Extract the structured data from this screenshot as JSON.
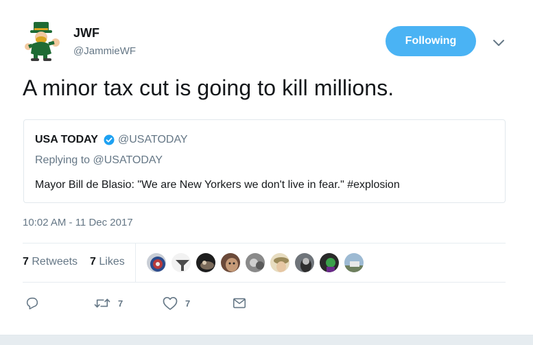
{
  "author": {
    "name": "JWF",
    "handle": "@JammieWF"
  },
  "follow_button": {
    "label": "Following"
  },
  "tweet_text": "A minor tax cut is going to kill millions.",
  "quoted": {
    "name": "USA TODAY",
    "handle": "@USATODAY",
    "replying_to": "Replying to @USATODAY",
    "text": "Mayor Bill de Blasio: \"We are New Yorkers we don't live in fear.\" #explosion"
  },
  "timestamp": "10:02 AM - 11 Dec 2017",
  "stats": {
    "retweets_count": "7",
    "retweets_label": "Retweets",
    "likes_count": "7",
    "likes_label": "Likes"
  },
  "actions": {
    "reply_count": "",
    "retweet_count": "7",
    "like_count": "7"
  },
  "colors": {
    "accent": "#4ab3f4",
    "secondary_text": "#657786",
    "primary_text": "#14171a",
    "border": "#e1e8ed"
  },
  "icons": [
    "reply-icon",
    "retweet-icon",
    "heart-icon",
    "message-icon",
    "caret-down-icon",
    "verified-icon"
  ]
}
